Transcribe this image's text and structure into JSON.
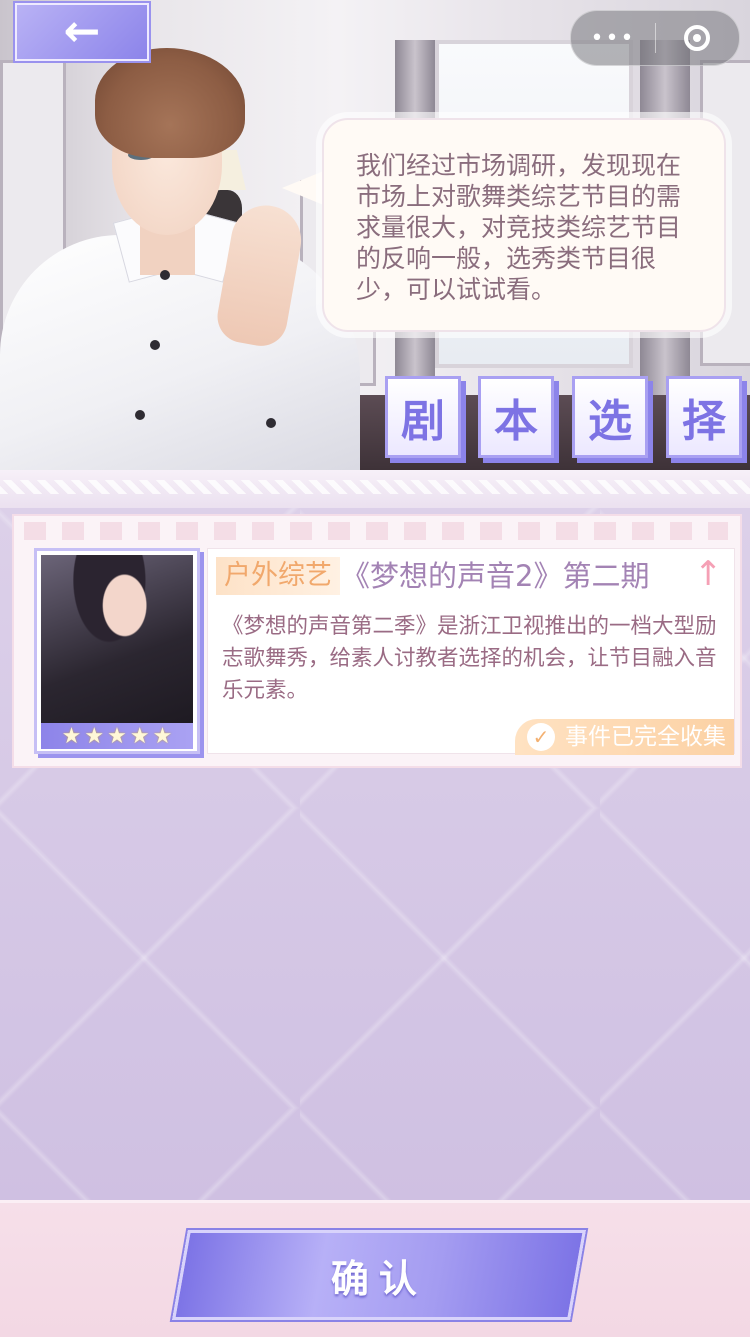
{
  "nav": {
    "back_label": "←",
    "capsule_more": "•••"
  },
  "dialog": {
    "text": "我们经过市场调研，发现现在市场上对歌舞类综艺节目的需求量很大，对竞技类综艺节目的反响一般，选秀类节目很少，可以试试看。"
  },
  "title_chars": [
    "剧",
    "本",
    "选",
    "择"
  ],
  "episode": {
    "tag": "户外综艺",
    "title": "《梦想的声音2》第二期",
    "arrow": "↑",
    "description": "《梦想的声音第二季》是浙江卫视推出的一档大型励志歌舞秀，给素人讨教者选择的机会，让节目融入音乐元素。",
    "stars": 5,
    "star_glyph": "★",
    "collected_label": "事件已完全收集",
    "check_glyph": "✓"
  },
  "confirm_label": "确认",
  "colors": {
    "accent_purple": "#8c84ea",
    "tag_orange": "#f1a86c",
    "dialog_text": "#8a6d7d"
  }
}
